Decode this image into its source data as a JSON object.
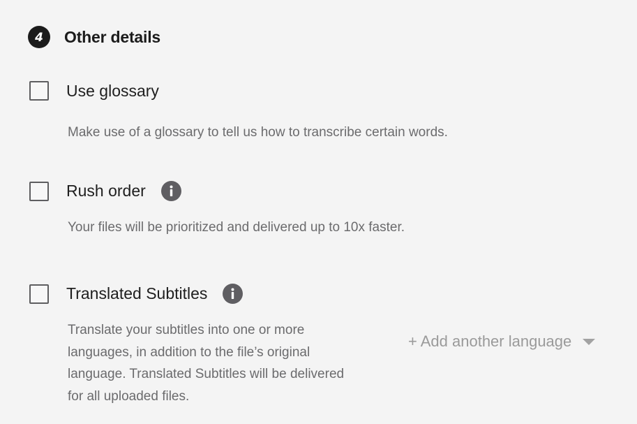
{
  "section": {
    "step_number": "4",
    "title": "Other details"
  },
  "options": [
    {
      "label": "Use glossary",
      "checked": false,
      "has_info": false,
      "description": "Make use of a glossary to tell us how to transcribe certain words."
    },
    {
      "label": "Rush order",
      "checked": false,
      "has_info": true,
      "description": "Your files will be prioritized and delivered up to 10x faster."
    },
    {
      "label": "Translated Subtitles",
      "checked": false,
      "has_info": true,
      "description_lines": [
        "Translate your subtitles into one or more",
        "languages, in addition to the file’s original",
        "language. Translated Subtitles will be delivered",
        "for all uploaded files."
      ]
    }
  ],
  "add_language": {
    "label": "+ Add another language",
    "icon": "chevron-down-icon"
  },
  "icons": {
    "info": "info-icon"
  },
  "colors": {
    "background": "#f4f4f4",
    "badge": "#1b1b1b",
    "info_icon": "#5f5e62",
    "muted_text": "#6b6b6d",
    "link_text": "#9a9a9a"
  }
}
